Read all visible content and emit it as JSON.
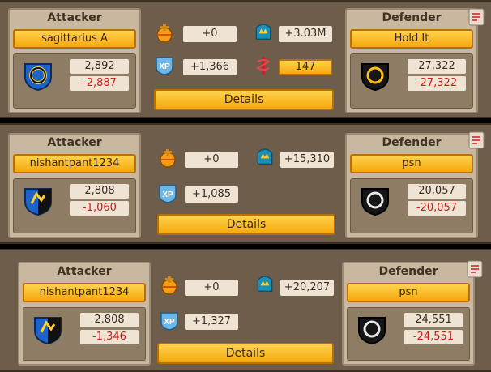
{
  "reports": [
    {
      "attacker_title": "Attacker",
      "attacker_name": "sagittarius A",
      "attacker_score": "2,892",
      "attacker_loss": "-2,887",
      "defender_title": "Defender",
      "defender_name": "Hold It",
      "defender_score": "27,322",
      "defender_loss": "-27,322",
      "orb_value": "+0",
      "xp_value": "+1,366",
      "might_value": "+3.03M",
      "medic_value": "147",
      "details_label": "Details"
    },
    {
      "attacker_title": "Attacker",
      "attacker_name": "nishantpant1234",
      "attacker_score": "2,808",
      "attacker_loss": "-1,060",
      "defender_title": "Defender",
      "defender_name": "psn",
      "defender_score": "20,057",
      "defender_loss": "-20,057",
      "orb_value": "+0",
      "xp_value": "+1,085",
      "might_value": "+15,310",
      "details_label": "Details"
    },
    {
      "attacker_title": "Attacker",
      "attacker_name": "nishantpant1234",
      "attacker_score": "2,808",
      "attacker_loss": "-1,346",
      "defender_title": "Defender",
      "defender_name": "psn",
      "defender_score": "24,551",
      "defender_loss": "-24,551",
      "orb_value": "+0",
      "xp_value": "+1,327",
      "might_value": "+20,207",
      "details_label": "Details"
    }
  ],
  "icons": {
    "orb": "orb-icon",
    "xp": "xp-icon",
    "might": "might-icon",
    "medic": "medic-icon",
    "report": "scroll-icon"
  },
  "colors": {
    "panel": "#6e5d4b",
    "side": "#c9b79f",
    "button": "#f4a90c",
    "loss": "#d11a1a"
  }
}
